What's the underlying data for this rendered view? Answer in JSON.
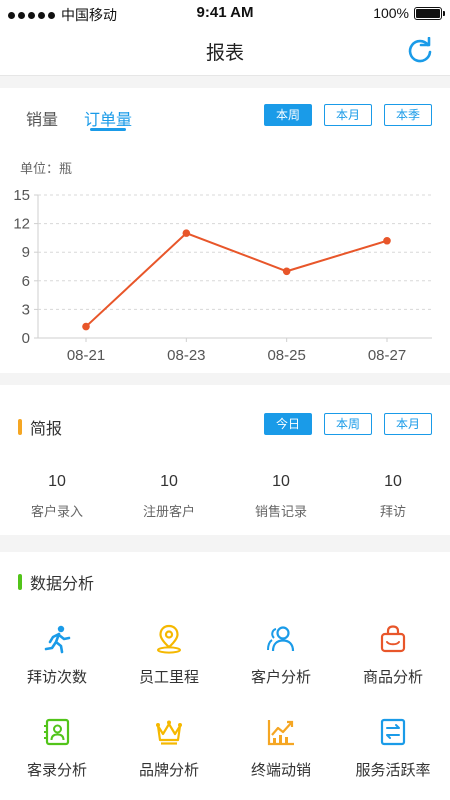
{
  "status_bar": {
    "carrier": "中国移动",
    "time": "9:41 AM",
    "battery": "100%"
  },
  "nav": {
    "title": "报表",
    "refresh_icon": "refresh-icon"
  },
  "report": {
    "tabs": [
      "销量",
      "订单量"
    ],
    "active_tab": "订单量",
    "periods": [
      "本周",
      "本月",
      "本季"
    ],
    "active_period": "本周",
    "unit_label": "单位：瓶"
  },
  "chart_data": {
    "type": "line",
    "x": [
      "08-21",
      "08-23",
      "08-25",
      "08-27"
    ],
    "series": [
      {
        "values": [
          1.2,
          11,
          7,
          10.2
        ]
      }
    ],
    "ylim": [
      0,
      15
    ],
    "yticks": [
      0,
      3,
      6,
      9,
      12,
      15
    ],
    "grid": true,
    "line_color": "#e8562a"
  },
  "brief": {
    "title": "简报",
    "accent": "#f5a623",
    "periods": [
      "今日",
      "本周",
      "本月"
    ],
    "active_period": "今日",
    "stats": [
      {
        "value": "10",
        "label": "客户录入"
      },
      {
        "value": "10",
        "label": "注册客户"
      },
      {
        "value": "10",
        "label": "销售记录"
      },
      {
        "value": "10",
        "label": "拜访"
      }
    ]
  },
  "analysis": {
    "title": "数据分析",
    "accent": "#52c41a",
    "items": [
      {
        "label": "拜访次数",
        "icon": "runner-icon",
        "color": "#1a9be8"
      },
      {
        "label": "员工里程",
        "icon": "location-pin-icon",
        "color": "#f5b800"
      },
      {
        "label": "客户分析",
        "icon": "users-icon",
        "color": "#1a9be8"
      },
      {
        "label": "商品分析",
        "icon": "shopping-bag-icon",
        "color": "#e8562a"
      },
      {
        "label": "客录分析",
        "icon": "contact-card-icon",
        "color": "#52c41a"
      },
      {
        "label": "品牌分析",
        "icon": "crown-icon",
        "color": "#f5b800"
      },
      {
        "label": "终端动销",
        "icon": "trend-chart-icon",
        "color": "#f5a623"
      },
      {
        "label": "服务活跃率",
        "icon": "transfer-icon",
        "color": "#1a9be8"
      }
    ]
  }
}
